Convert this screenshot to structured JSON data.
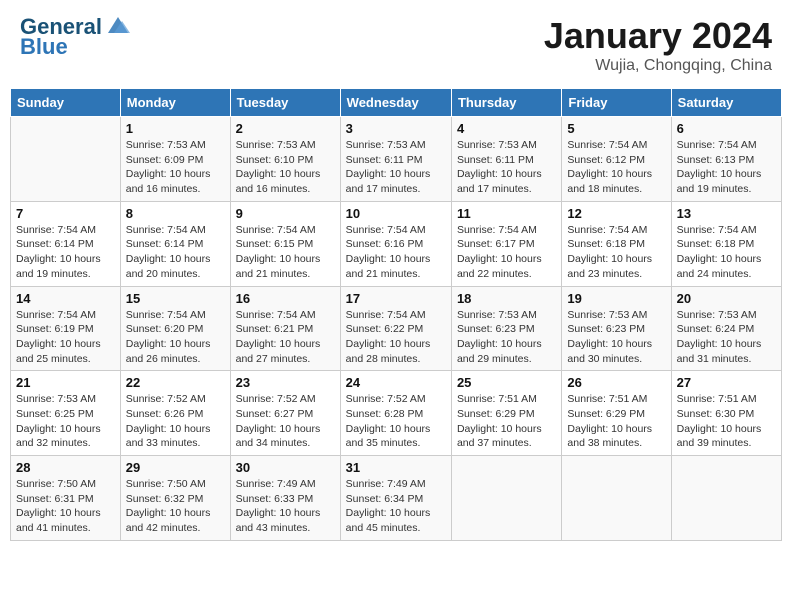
{
  "header": {
    "logo_line1": "General",
    "logo_line2": "Blue",
    "month_year": "January 2024",
    "location": "Wujia, Chongqing, China"
  },
  "weekdays": [
    "Sunday",
    "Monday",
    "Tuesday",
    "Wednesday",
    "Thursday",
    "Friday",
    "Saturday"
  ],
  "weeks": [
    [
      {
        "day": "",
        "info": ""
      },
      {
        "day": "1",
        "info": "Sunrise: 7:53 AM\nSunset: 6:09 PM\nDaylight: 10 hours\nand 16 minutes."
      },
      {
        "day": "2",
        "info": "Sunrise: 7:53 AM\nSunset: 6:10 PM\nDaylight: 10 hours\nand 16 minutes."
      },
      {
        "day": "3",
        "info": "Sunrise: 7:53 AM\nSunset: 6:11 PM\nDaylight: 10 hours\nand 17 minutes."
      },
      {
        "day": "4",
        "info": "Sunrise: 7:53 AM\nSunset: 6:11 PM\nDaylight: 10 hours\nand 17 minutes."
      },
      {
        "day": "5",
        "info": "Sunrise: 7:54 AM\nSunset: 6:12 PM\nDaylight: 10 hours\nand 18 minutes."
      },
      {
        "day": "6",
        "info": "Sunrise: 7:54 AM\nSunset: 6:13 PM\nDaylight: 10 hours\nand 19 minutes."
      }
    ],
    [
      {
        "day": "7",
        "info": "Sunrise: 7:54 AM\nSunset: 6:14 PM\nDaylight: 10 hours\nand 19 minutes."
      },
      {
        "day": "8",
        "info": "Sunrise: 7:54 AM\nSunset: 6:14 PM\nDaylight: 10 hours\nand 20 minutes."
      },
      {
        "day": "9",
        "info": "Sunrise: 7:54 AM\nSunset: 6:15 PM\nDaylight: 10 hours\nand 21 minutes."
      },
      {
        "day": "10",
        "info": "Sunrise: 7:54 AM\nSunset: 6:16 PM\nDaylight: 10 hours\nand 21 minutes."
      },
      {
        "day": "11",
        "info": "Sunrise: 7:54 AM\nSunset: 6:17 PM\nDaylight: 10 hours\nand 22 minutes."
      },
      {
        "day": "12",
        "info": "Sunrise: 7:54 AM\nSunset: 6:18 PM\nDaylight: 10 hours\nand 23 minutes."
      },
      {
        "day": "13",
        "info": "Sunrise: 7:54 AM\nSunset: 6:18 PM\nDaylight: 10 hours\nand 24 minutes."
      }
    ],
    [
      {
        "day": "14",
        "info": "Sunrise: 7:54 AM\nSunset: 6:19 PM\nDaylight: 10 hours\nand 25 minutes."
      },
      {
        "day": "15",
        "info": "Sunrise: 7:54 AM\nSunset: 6:20 PM\nDaylight: 10 hours\nand 26 minutes."
      },
      {
        "day": "16",
        "info": "Sunrise: 7:54 AM\nSunset: 6:21 PM\nDaylight: 10 hours\nand 27 minutes."
      },
      {
        "day": "17",
        "info": "Sunrise: 7:54 AM\nSunset: 6:22 PM\nDaylight: 10 hours\nand 28 minutes."
      },
      {
        "day": "18",
        "info": "Sunrise: 7:53 AM\nSunset: 6:23 PM\nDaylight: 10 hours\nand 29 minutes."
      },
      {
        "day": "19",
        "info": "Sunrise: 7:53 AM\nSunset: 6:23 PM\nDaylight: 10 hours\nand 30 minutes."
      },
      {
        "day": "20",
        "info": "Sunrise: 7:53 AM\nSunset: 6:24 PM\nDaylight: 10 hours\nand 31 minutes."
      }
    ],
    [
      {
        "day": "21",
        "info": "Sunrise: 7:53 AM\nSunset: 6:25 PM\nDaylight: 10 hours\nand 32 minutes."
      },
      {
        "day": "22",
        "info": "Sunrise: 7:52 AM\nSunset: 6:26 PM\nDaylight: 10 hours\nand 33 minutes."
      },
      {
        "day": "23",
        "info": "Sunrise: 7:52 AM\nSunset: 6:27 PM\nDaylight: 10 hours\nand 34 minutes."
      },
      {
        "day": "24",
        "info": "Sunrise: 7:52 AM\nSunset: 6:28 PM\nDaylight: 10 hours\nand 35 minutes."
      },
      {
        "day": "25",
        "info": "Sunrise: 7:51 AM\nSunset: 6:29 PM\nDaylight: 10 hours\nand 37 minutes."
      },
      {
        "day": "26",
        "info": "Sunrise: 7:51 AM\nSunset: 6:29 PM\nDaylight: 10 hours\nand 38 minutes."
      },
      {
        "day": "27",
        "info": "Sunrise: 7:51 AM\nSunset: 6:30 PM\nDaylight: 10 hours\nand 39 minutes."
      }
    ],
    [
      {
        "day": "28",
        "info": "Sunrise: 7:50 AM\nSunset: 6:31 PM\nDaylight: 10 hours\nand 41 minutes."
      },
      {
        "day": "29",
        "info": "Sunrise: 7:50 AM\nSunset: 6:32 PM\nDaylight: 10 hours\nand 42 minutes."
      },
      {
        "day": "30",
        "info": "Sunrise: 7:49 AM\nSunset: 6:33 PM\nDaylight: 10 hours\nand 43 minutes."
      },
      {
        "day": "31",
        "info": "Sunrise: 7:49 AM\nSunset: 6:34 PM\nDaylight: 10 hours\nand 45 minutes."
      },
      {
        "day": "",
        "info": ""
      },
      {
        "day": "",
        "info": ""
      },
      {
        "day": "",
        "info": ""
      }
    ]
  ]
}
